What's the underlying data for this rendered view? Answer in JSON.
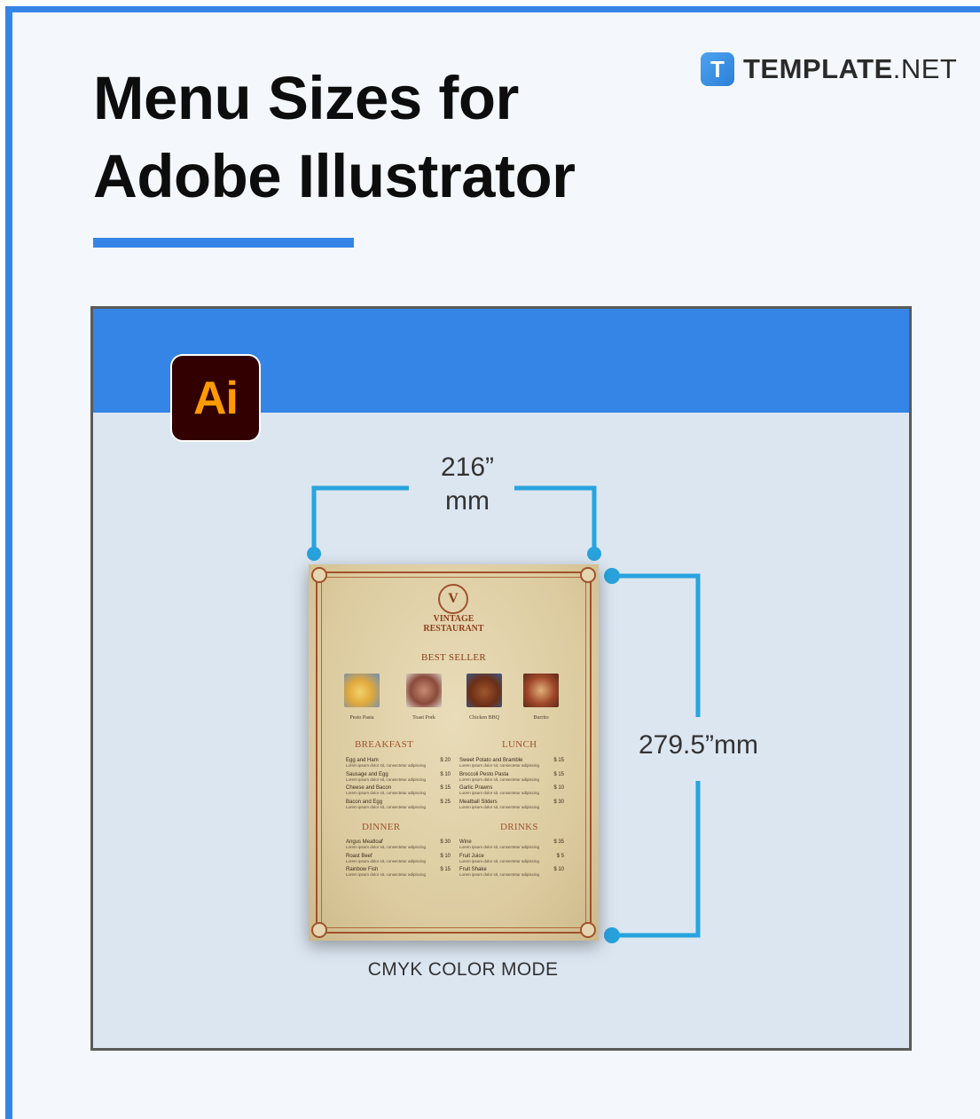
{
  "header": {
    "title_lines": [
      "Menu Sizes for",
      "Adobe Illustrator"
    ]
  },
  "brand": {
    "icon_letter": "T",
    "name_bold": "TEMPLATE",
    "name_suffix": ".NET"
  },
  "panel": {
    "app_logo_text": "Ai",
    "width_label_line1": "216”",
    "width_label_line2": "mm",
    "height_label": "279.5”mm",
    "caption": "CMYK COLOR MODE"
  },
  "menu_sample": {
    "emblem_letter": "V",
    "restaurant_line1": "VINTAGE",
    "restaurant_line2": "RESTAURANT",
    "best_seller_heading": "BEST SELLER",
    "best_sellers": [
      "Pesto Pasta",
      "Toast Pork",
      "Chicken BBQ",
      "Burrito"
    ],
    "sections": [
      {
        "heading": "BREAKFAST",
        "items": [
          {
            "name": "Egg and Ham",
            "price": "$ 20",
            "desc": "Lorem ipsum dolor sit, consectetur adipiscing"
          },
          {
            "name": "Sausage and Egg",
            "price": "$ 10",
            "desc": "Lorem ipsum dolor sit, consectetur adipiscing"
          },
          {
            "name": "Cheese and Bacon",
            "price": "$ 15",
            "desc": "Lorem ipsum dolor sit, consectetur adipiscing"
          },
          {
            "name": "Bacon and Egg",
            "price": "$ 25",
            "desc": "Lorem ipsum dolor sit, consectetur adipiscing"
          }
        ]
      },
      {
        "heading": "LUNCH",
        "items": [
          {
            "name": "Sweet Potato and Bramble",
            "price": "$ 15",
            "desc": "Lorem ipsum dolor sit, consectetur adipiscing"
          },
          {
            "name": "Broccoli Pesto Pasta",
            "price": "$ 15",
            "desc": "Lorem ipsum dolor sit, consectetur adipiscing"
          },
          {
            "name": "Garlic Prawns",
            "price": "$ 10",
            "desc": "Lorem ipsum dolor sit, consectetur adipiscing"
          },
          {
            "name": "Meatball Sliders",
            "price": "$ 30",
            "desc": "Lorem ipsum dolor sit, consectetur adipiscing"
          }
        ]
      },
      {
        "heading": "DINNER",
        "items": [
          {
            "name": "Angus Meatloaf",
            "price": "$ 30",
            "desc": "Lorem ipsum dolor sit, consectetur adipiscing"
          },
          {
            "name": "Roast Beef",
            "price": "$ 10",
            "desc": "Lorem ipsum dolor sit, consectetur adipiscing"
          },
          {
            "name": "Rainbow Fish",
            "price": "$ 15",
            "desc": "Lorem ipsum dolor sit, consectetur adipiscing"
          }
        ]
      },
      {
        "heading": "DRINKS",
        "items": [
          {
            "name": "Wine",
            "price": "$ 35",
            "desc": "Lorem ipsum dolor sit, consectetur adipiscing"
          },
          {
            "name": "Fruit Juice",
            "price": "$ 5",
            "desc": "Lorem ipsum dolor sit, consectetur adipiscing"
          },
          {
            "name": "Fruit Shake",
            "price": "$ 10",
            "desc": "Lorem ipsum dolor sit, consectetur adipiscing"
          }
        ]
      }
    ]
  },
  "colors": {
    "accent_blue": "#3585e6",
    "dimension_cyan": "#29a3dd",
    "ai_logo_bg": "#330000",
    "ai_logo_text": "#ff9a00",
    "panel_bg": "#dce6f1"
  }
}
